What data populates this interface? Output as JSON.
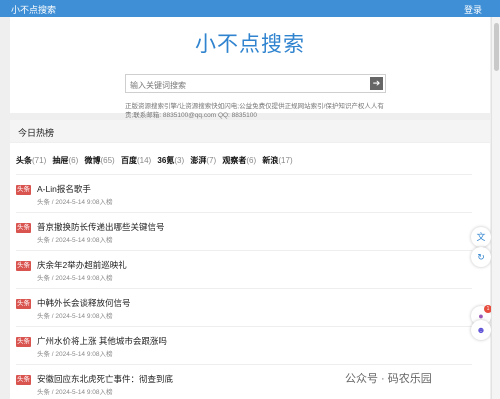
{
  "topbar": {
    "brand": "小不点搜索",
    "login": "登录"
  },
  "hero": {
    "logo": "小不点搜索",
    "search_placeholder": "输入关键词搜索",
    "search_button_icon": "arrow-right-icon",
    "disclaimer": "正版资源搜索引擎/让资源搜索快如闪电;公益免费仅提供正规网站索引/保护知识产权人人有责;联系邮箱: 8835100@qq.com QQ: 8835100"
  },
  "section": {
    "title": "今日热榜"
  },
  "tabs": [
    {
      "name": "头条",
      "count": "(71)"
    },
    {
      "name": "抽屉",
      "count": "(6)"
    },
    {
      "name": "微博",
      "count": "(65)"
    },
    {
      "name": "百度",
      "count": "(14)"
    },
    {
      "name": "36氪",
      "count": "(3)"
    },
    {
      "name": "澎湃",
      "count": "(7)"
    },
    {
      "name": "观察者",
      "count": "(6)"
    },
    {
      "name": "新浪",
      "count": "(17)"
    }
  ],
  "items": [
    {
      "tag": "头条",
      "title": "A-Lin报名歌手",
      "meta": "头条 / 2024-5-14 9:08入榜"
    },
    {
      "tag": "头条",
      "title": "普京撤换防长传递出哪些关键信号",
      "meta": "头条 / 2024-5-14 9:08入榜"
    },
    {
      "tag": "头条",
      "title": "庆余年2举办超前巡映礼",
      "meta": "头条 / 2024-5-14 9:08入榜"
    },
    {
      "tag": "头条",
      "title": "中韩外长会谈释放何信号",
      "meta": "头条 / 2024-5-14 9:08入榜"
    },
    {
      "tag": "头条",
      "title": "广州水价将上涨 其他城市会跟涨吗",
      "meta": "头条 / 2024-5-14 9:08入榜"
    },
    {
      "tag": "头条",
      "title": "安徽回应东北虎死亡事件：彻查到底",
      "meta": "头条 / 2024-5-14 9:08入榜"
    }
  ],
  "side": {
    "translate_icon": "translate-icon",
    "refresh_icon": "refresh-icon",
    "chat_icon": "chat-icon",
    "location_icon": "location-icon",
    "badge": "1"
  },
  "watermark": "公众号 · 码农乐园",
  "colors": {
    "accent": "#3f8fd6",
    "tag": "#d9534f"
  }
}
